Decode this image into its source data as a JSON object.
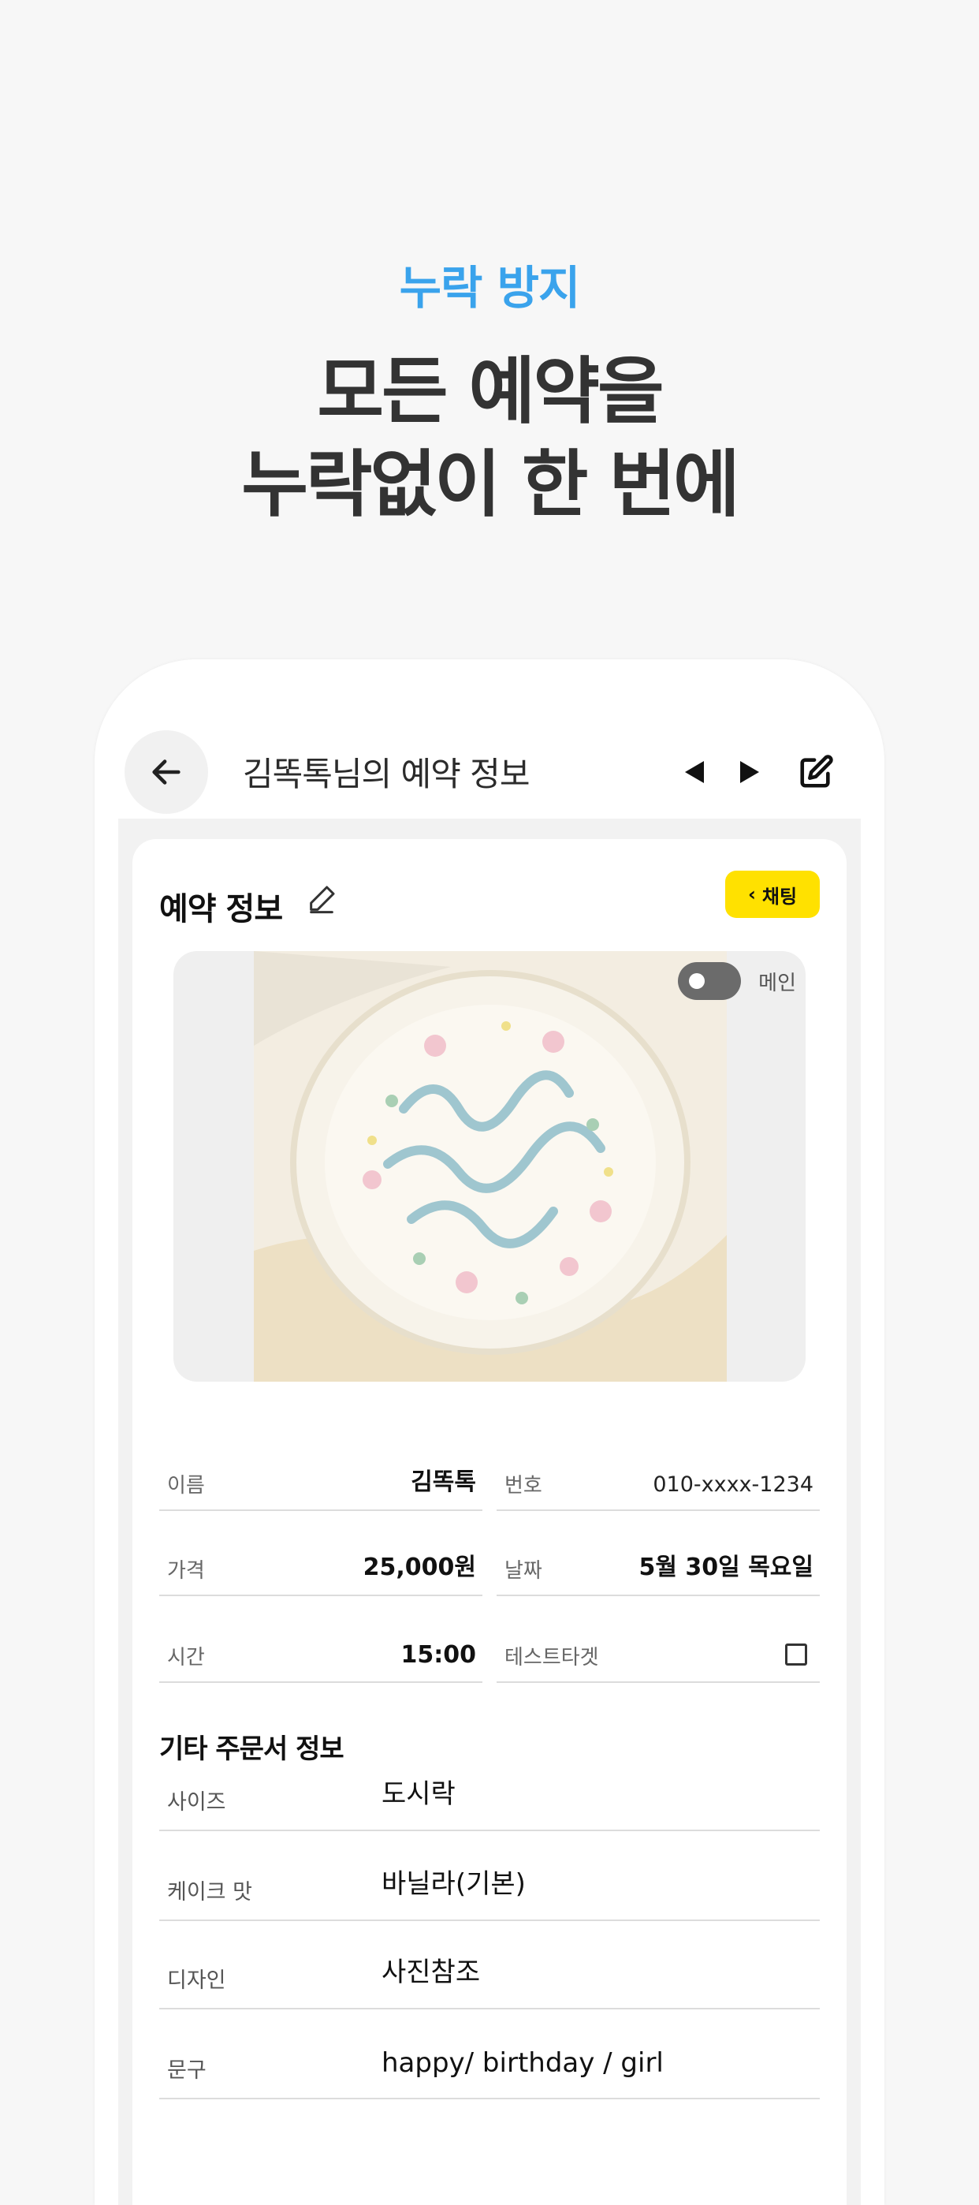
{
  "hero": {
    "eyebrow": "누락 방지",
    "title_line1": "모든 예약을",
    "title_line2": "누락없이 한 번에"
  },
  "topbar": {
    "title": "김똑톡님의 예약 정보",
    "icons": [
      "arrow-left-icon",
      "triangle-left-icon",
      "triangle-right-icon",
      "edit-square-icon"
    ]
  },
  "reservation": {
    "section_title": "예약 정보",
    "chat_button": "채팅",
    "photo": {
      "toggle_label": "메인",
      "toggle_on": false
    },
    "fields": {
      "name_label": "이름",
      "name_value": "김똑톡",
      "phone_label": "번호",
      "phone_value": "010-xxxx-1234",
      "price_label": "가격",
      "price_value": "25,000원",
      "date_label": "날짜",
      "date_value": "5월 30일 목요일",
      "time_label": "시간",
      "time_value": "15:00",
      "test_label": "테스트타겟",
      "test_checked": false
    }
  },
  "order_info": {
    "title": "기타 주문서 정보",
    "rows": [
      {
        "label": "사이즈",
        "value": "도시락"
      },
      {
        "label": "케이크 맛",
        "value": "바닐라(기본)"
      },
      {
        "label": "디자인",
        "value": "사진참조"
      },
      {
        "label": "문구",
        "value": "happy/ birthday / girl"
      }
    ]
  },
  "colors": {
    "accent_blue": "#3aa3ec",
    "chat_yellow": "#ffe100",
    "background": "#f7f7f7"
  }
}
